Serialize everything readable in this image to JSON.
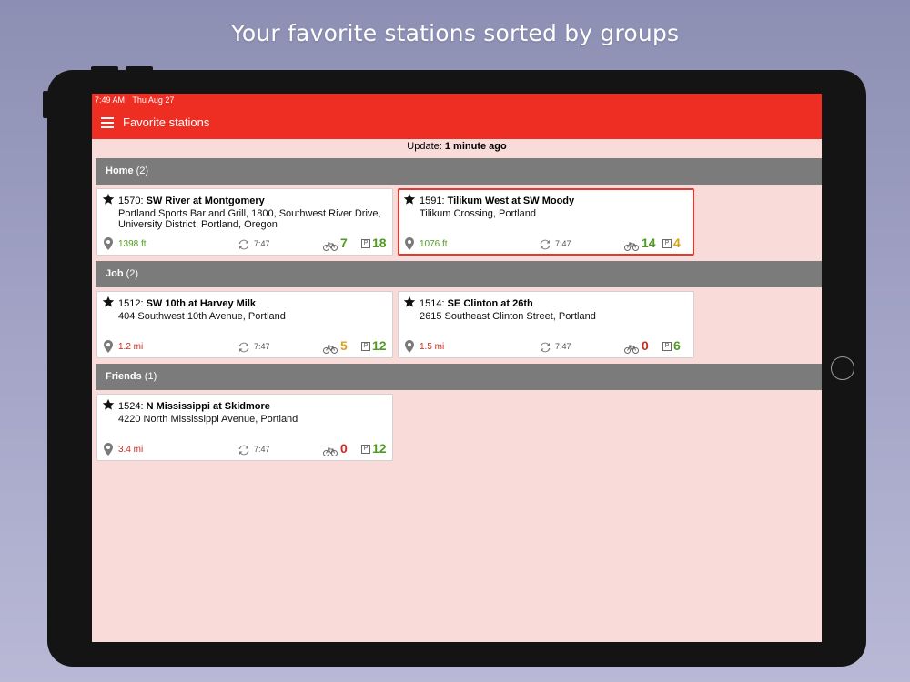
{
  "promo": {
    "headline": "Your favorite stations sorted by groups"
  },
  "statusbar": {
    "time": "7:49 AM",
    "date": "Thu Aug 27"
  },
  "appbar": {
    "title": "Favorite stations",
    "menu_icon": "hamburger-menu-icon"
  },
  "update": {
    "label": "Update:",
    "value": "1 minute ago"
  },
  "colors": {
    "appbar": "#ee2e22",
    "screen_bg": "#f9dcd9",
    "group_header": "#7b7b7b",
    "good": "#4e9a1e",
    "medium": "#d8a21c",
    "bad": "#d0291e",
    "selected_border": "#e2392c"
  },
  "icons": {
    "favorite": "star-icon",
    "distance": "location-pin-icon",
    "updated": "refresh-icon",
    "bikes": "bicycle-icon",
    "docks": "parking-icon"
  },
  "groups": [
    {
      "name": "Home",
      "count": "(2)",
      "stations": [
        {
          "id": "1570:",
          "name": "SW River at Montgomery",
          "address": "Portland Sports Bar and Grill, 1800, Southwest River Drive, University District, Portland, Oregon",
          "distance": "1398 ft",
          "distance_color": "#4e9a1e",
          "time": "7:47",
          "bikes": "7",
          "bikes_color": "#4e9a1e",
          "parking_label": "P",
          "docks": "18",
          "docks_color": "#4e9a1e",
          "selected": false
        },
        {
          "id": "1591:",
          "name": "Tilikum West at SW Moody",
          "address": "Tilikum Crossing, Portland",
          "distance": "1076 ft",
          "distance_color": "#4e9a1e",
          "time": "7:47",
          "bikes": "14",
          "bikes_color": "#4e9a1e",
          "parking_label": "P",
          "docks": "4",
          "docks_color": "#d8a21c",
          "selected": true
        }
      ]
    },
    {
      "name": "Job",
      "count": "(2)",
      "stations": [
        {
          "id": "1512:",
          "name": "SW 10th at Harvey Milk",
          "address": "404 Southwest 10th Avenue, Portland",
          "distance": "1.2 mi",
          "distance_color": "#d0291e",
          "time": "7:47",
          "bikes": "5",
          "bikes_color": "#d8a21c",
          "parking_label": "P",
          "docks": "12",
          "docks_color": "#4e9a1e",
          "selected": false
        },
        {
          "id": "1514:",
          "name": "SE Clinton at 26th",
          "address": "2615 Southeast Clinton Street, Portland",
          "distance": "1.5 mi",
          "distance_color": "#d0291e",
          "time": "7:47",
          "bikes": "0",
          "bikes_color": "#d0291e",
          "parking_label": "P",
          "docks": "6",
          "docks_color": "#4e9a1e",
          "selected": false
        }
      ]
    },
    {
      "name": "Friends",
      "count": "(1)",
      "stations": [
        {
          "id": "1524:",
          "name": "N Mississippi at Skidmore",
          "address": "4220 North Mississippi Avenue, Portland",
          "distance": "3.4 mi",
          "distance_color": "#d0291e",
          "time": "7:47",
          "bikes": "0",
          "bikes_color": "#d0291e",
          "parking_label": "P",
          "docks": "12",
          "docks_color": "#4e9a1e",
          "selected": false
        }
      ]
    }
  ]
}
